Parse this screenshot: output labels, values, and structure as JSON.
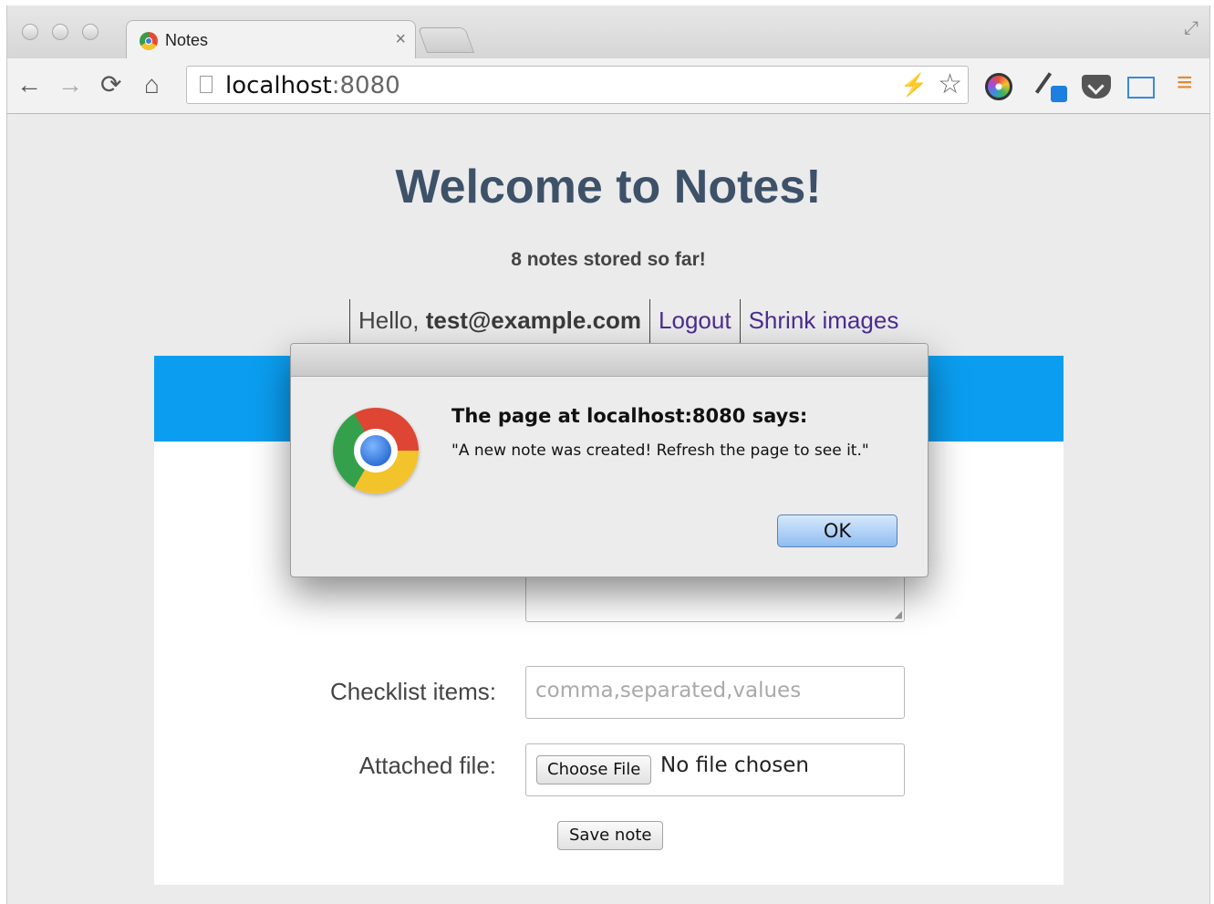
{
  "browser": {
    "tab_title": "Notes",
    "tab_close": "×",
    "url_host": "localhost",
    "url_port": ":8080",
    "nav_back": "←",
    "nav_forward": "→",
    "nav_reload": "⟳",
    "nav_home": "⌂",
    "bolt": "⚡",
    "star": "☆",
    "menu": "≡",
    "fullscreen": "⤢"
  },
  "page": {
    "heading": "Welcome to Notes!",
    "notes_count": "8 notes stored so far!",
    "nav": {
      "hello_prefix": "Hello, ",
      "user_email": "test@example.com",
      "logout": "Logout",
      "shrink_images": "Shrink images"
    }
  },
  "form": {
    "checklist_label": "Checklist items:",
    "checklist_placeholder": "comma,separated,values",
    "file_label": "Attached file:",
    "choose_file": "Choose File",
    "no_file": "No file chosen",
    "save_button": "Save note"
  },
  "dialog": {
    "title": "The page at localhost:8080 says:",
    "message": "\"A new note was created! Refresh the page to see it.\"",
    "ok_button": "OK"
  }
}
